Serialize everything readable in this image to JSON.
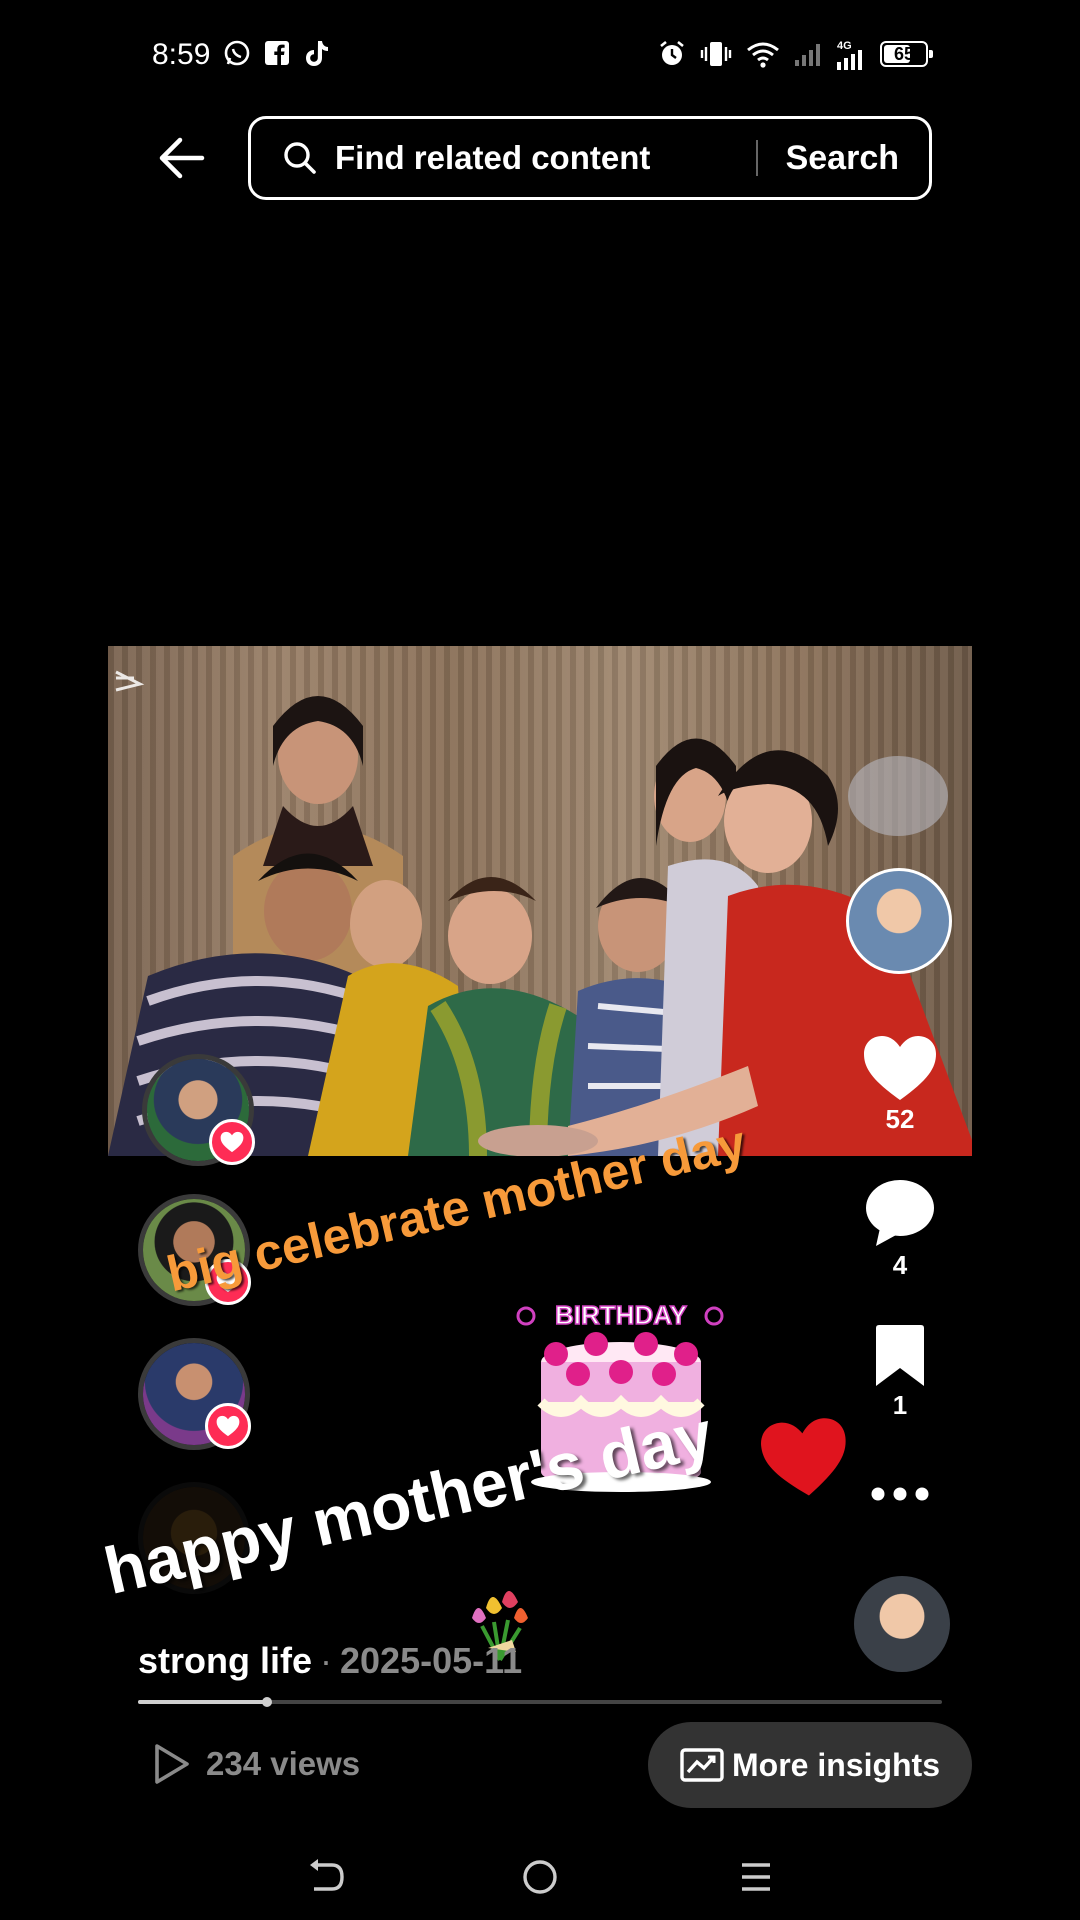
{
  "status_bar": {
    "time": "8:59",
    "battery": "65",
    "left_icons": [
      "whatsapp-icon",
      "facebook-icon",
      "tiktok-icon"
    ],
    "right_icons": [
      "alarm-icon",
      "vibrate-icon",
      "wifi-icon",
      "signal-weak-icon",
      "signal-4g-icon",
      "battery-icon"
    ],
    "network_label": "4G"
  },
  "header": {
    "search_placeholder": "Find related content",
    "search_button": "Search"
  },
  "video": {
    "overlay_texts": {
      "orange": "big celebrate mother day",
      "white": "happy mother's day"
    },
    "cake_label": "BIRTHDAY"
  },
  "actions": {
    "like_count": "52",
    "comment_count": "4",
    "save_count": "1"
  },
  "post": {
    "author": "strong life",
    "separator": "·",
    "date": "2025-05-11",
    "progress": 0.16
  },
  "footer": {
    "views_label": "234 views",
    "insights_label": "More insights"
  },
  "colors": {
    "accent_like": "#fe2c55",
    "overlay_orange": "#f79a3a",
    "muted_text": "#8a8a8a"
  }
}
